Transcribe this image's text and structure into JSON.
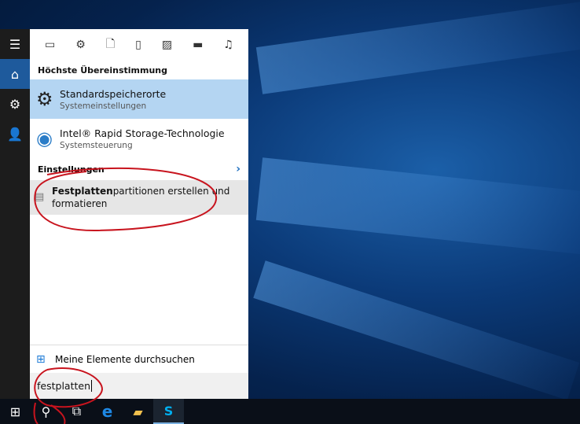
{
  "filters": [
    "tablet-icon",
    "gear-icon",
    "document-icon",
    "device-icon",
    "image-icon",
    "video-icon",
    "music-icon"
  ],
  "sidebar": [
    "menu-icon",
    "home-icon",
    "settings-icon",
    "feedback-icon"
  ],
  "best_match": {
    "header": "Höchste Übereinstimmung",
    "items": [
      {
        "title": "Standardspeicherorte",
        "subtitle": "Systemeinstellungen",
        "icon": "gear-icon"
      },
      {
        "title": "Intel® Rapid Storage-Technologie",
        "subtitle": "Systemsteuerung",
        "icon": "intel-rst-icon"
      }
    ]
  },
  "settings": {
    "header": "Einstellungen",
    "item_bold": "Festplatten",
    "item_rest": "partitionen erstellen und formatieren"
  },
  "my_stuff": "Meine Elemente durchsuchen",
  "search": {
    "value": "festplatten"
  },
  "taskbar": [
    "start-icon",
    "search-icon",
    "task-view-icon",
    "edge-icon",
    "file-explorer-icon",
    "skype-icon"
  ],
  "colors": {
    "selected": "#b4d5f2",
    "accent": "#1e5a9c",
    "annotation": "#c8141e"
  }
}
